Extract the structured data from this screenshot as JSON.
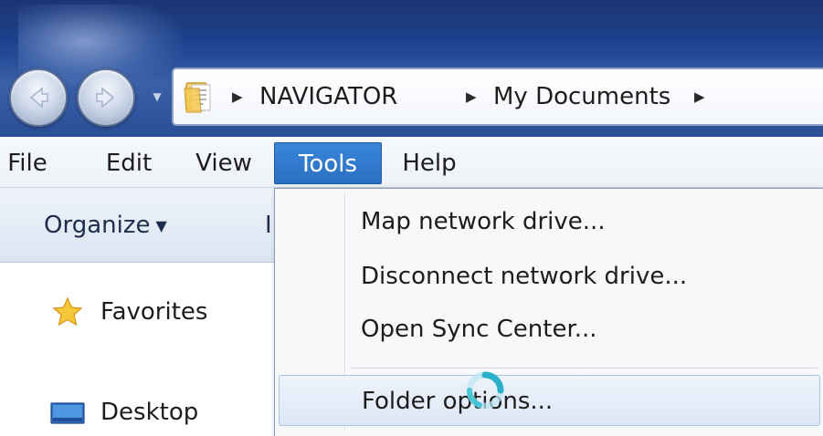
{
  "address": {
    "crumbs": [
      "NAVIGATOR",
      "My Documents"
    ],
    "separator_icon": "breadcrumb-arrow-icon",
    "folder_icon": "folder-icon"
  },
  "nav_buttons": {
    "back_icon": "back-arrow-icon",
    "forward_icon": "forward-arrow-icon",
    "recent_icon": "chevron-down-icon"
  },
  "menubar": {
    "items": [
      "File",
      "Edit",
      "View",
      "Tools",
      "Help"
    ],
    "active": "Tools"
  },
  "commandbar": {
    "organize_label": "Organize",
    "clipped_label": "I"
  },
  "navpane": {
    "items": [
      {
        "label": "Favorites",
        "icon": "star-icon"
      },
      {
        "label": "Desktop",
        "icon": "desktop-icon"
      }
    ]
  },
  "tools_menu": {
    "items": [
      "Map network drive...",
      "Disconnect network drive...",
      "Open Sync Center...",
      "Folder options..."
    ],
    "hovered": "Folder options..."
  },
  "colors": {
    "menu_highlight": "#2f78cc",
    "title_glass": "#1b3f8c",
    "hover_item": "#dce7f6"
  }
}
